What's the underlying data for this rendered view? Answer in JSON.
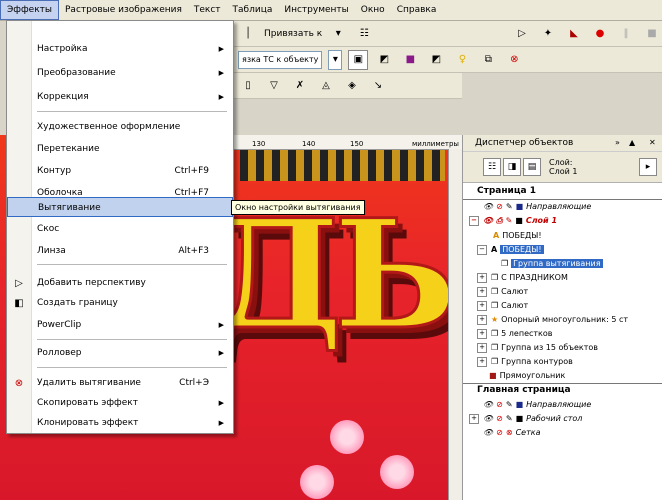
{
  "menubar": [
    "Эффекты",
    "Растровые изображения",
    "Текст",
    "Таблица",
    "Инструменты",
    "Окно",
    "Справка"
  ],
  "toolbar": {
    "snap_label": "Привязать к",
    "combo_label": "язка ТС к объекту",
    "ruler_ticks": [
      "130",
      "140",
      "150"
    ],
    "ruler_units": "миллиметры"
  },
  "menu": {
    "items": [
      {
        "label": "Настройка",
        "arrow": "▶"
      },
      {
        "label": "Преобразование",
        "arrow": "▶"
      },
      {
        "label": "Коррекция",
        "arrow": "▶"
      },
      {
        "label": "Художественное оформление"
      },
      {
        "label": "Перетекание"
      },
      {
        "label": "Контур",
        "shortcut": "Ctrl+F9"
      },
      {
        "label": "Оболочка",
        "shortcut": "Ctrl+F7"
      },
      {
        "label": "Вытягивание"
      },
      {
        "label": "Скос"
      },
      {
        "label": "Линза",
        "shortcut": "Alt+F3"
      },
      {
        "label": "Добавить перспективу"
      },
      {
        "label": "Создать границу"
      },
      {
        "label": "PowerClip",
        "arrow": "▶"
      },
      {
        "label": "Ролловер",
        "arrow": "▶"
      },
      {
        "label": "Удалить вытягивание",
        "shortcut": "Ctrl+Э"
      },
      {
        "label": "Скопировать эффект",
        "arrow": "▶"
      },
      {
        "label": "Клонировать эффект",
        "arrow": "▶"
      }
    ]
  },
  "tooltip": "Окно настройки вытягивания",
  "panel": {
    "title": "Диспетчер объектов",
    "layer_label": "Слой:",
    "layer_name": "Слой 1",
    "tree": [
      {
        "label": "Страница 1"
      },
      {
        "label": "Направляющие"
      },
      {
        "label": "Слой 1"
      },
      {
        "label": "ПОБЕДЫ!"
      },
      {
        "label": "ПОБЕДЫ!"
      },
      {
        "label": "Группа вытягивания"
      },
      {
        "label": "С ПРАЗДНИКОМ"
      },
      {
        "label": "Салют"
      },
      {
        "label": "Салют"
      },
      {
        "label": "Опорный многоугольник: 5 ст"
      },
      {
        "label": "5 лепестков"
      },
      {
        "label": "Группа из 15 объектов"
      },
      {
        "label": "Группа контуров"
      },
      {
        "label": "Прямоугольник"
      },
      {
        "label": "Главная страница"
      },
      {
        "label": "Направляющие"
      },
      {
        "label": "Рабочий стол"
      },
      {
        "label": "Сетка"
      }
    ]
  },
  "colors": {
    "menu_highlight": "#c1d2ee",
    "selection": "#316ac5",
    "banner_text": "#f6d11a",
    "canvas": "#e8242a"
  }
}
